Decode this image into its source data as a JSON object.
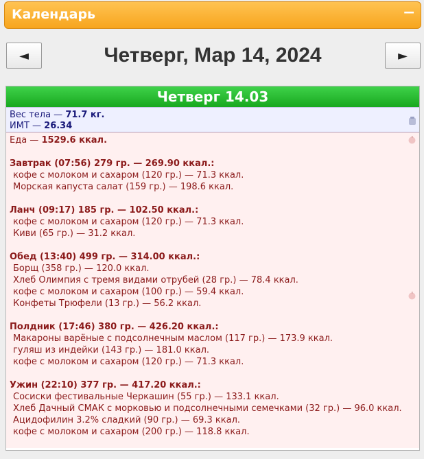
{
  "panel": {
    "title": "Календарь",
    "collapse_symbol": "−"
  },
  "nav": {
    "prev": "◄",
    "next": "►",
    "date": "Четверг, Мар 14, 2024"
  },
  "day": {
    "header": "Четверг 14.03",
    "weight_label": "Вес тела — ",
    "weight_value": "71.7 кг.",
    "bmi_label": "ИМТ — ",
    "bmi_value": "26.34",
    "food_label": "Еда — ",
    "food_value": "1529.6 ккал.",
    "meals": [
      {
        "head": "Завтрак (07:56) 279 гр. — 269.90 ккал.:",
        "items": [
          "кофе с молоком и сахаром (120 гр.) — 71.3 ккал.",
          "Морская капуста салат (159 гр.) — 198.6 ккал."
        ]
      },
      {
        "head": "Ланч (09:17) 185 гр. — 102.50 ккал.:",
        "items": [
          "кофе с молоком и сахаром (120 гр.) — 71.3 ккал.",
          "Киви (65 гр.) — 31.2 ккал."
        ]
      },
      {
        "head": "Обед (13:40) 499 гр. — 314.00 ккал.:",
        "items": [
          "Борщ (358 гр.) — 120.0 ккал.",
          "Хлеб Олимпия с тремя видами отрубей (28 гр.) — 78.4 ккал.",
          "кофе с молоком и сахаром (100 гр.) — 59.4 ккал.",
          "Конфеты Трюфели (13 гр.) — 56.2 ккал."
        ]
      },
      {
        "head": "Полдник (17:46) 380 гр. — 426.20 ккал.:",
        "items": [
          "Макароны варёные с подсолнечным маслом (117 гр.) — 173.9 ккал.",
          "гуляш из индейки (143 гр.) — 181.0 ккал.",
          "кофе с молоком и сахаром (120 гр.) — 71.3 ккал."
        ]
      },
      {
        "head": "Ужин (22:10) 377 гр. — 417.20 ккал.:",
        "items": [
          "Сосиски фестивальные Черкашин (55 гр.) — 133.1 ккал.",
          "Хлеб Дачный СМАК с морковью и подсолнечными семечками (32 гр.) — 96.0 ккал.",
          "Ацидофилин 3.2% сладкий (90 гр.) — 69.3 ккал.",
          "кофе с молоком и сахаром (200 гр.) — 118.8 ккал."
        ]
      }
    ]
  },
  "icons": {
    "collapse": "minus-icon",
    "weight": "scale-icon",
    "food": "apple-icon"
  }
}
